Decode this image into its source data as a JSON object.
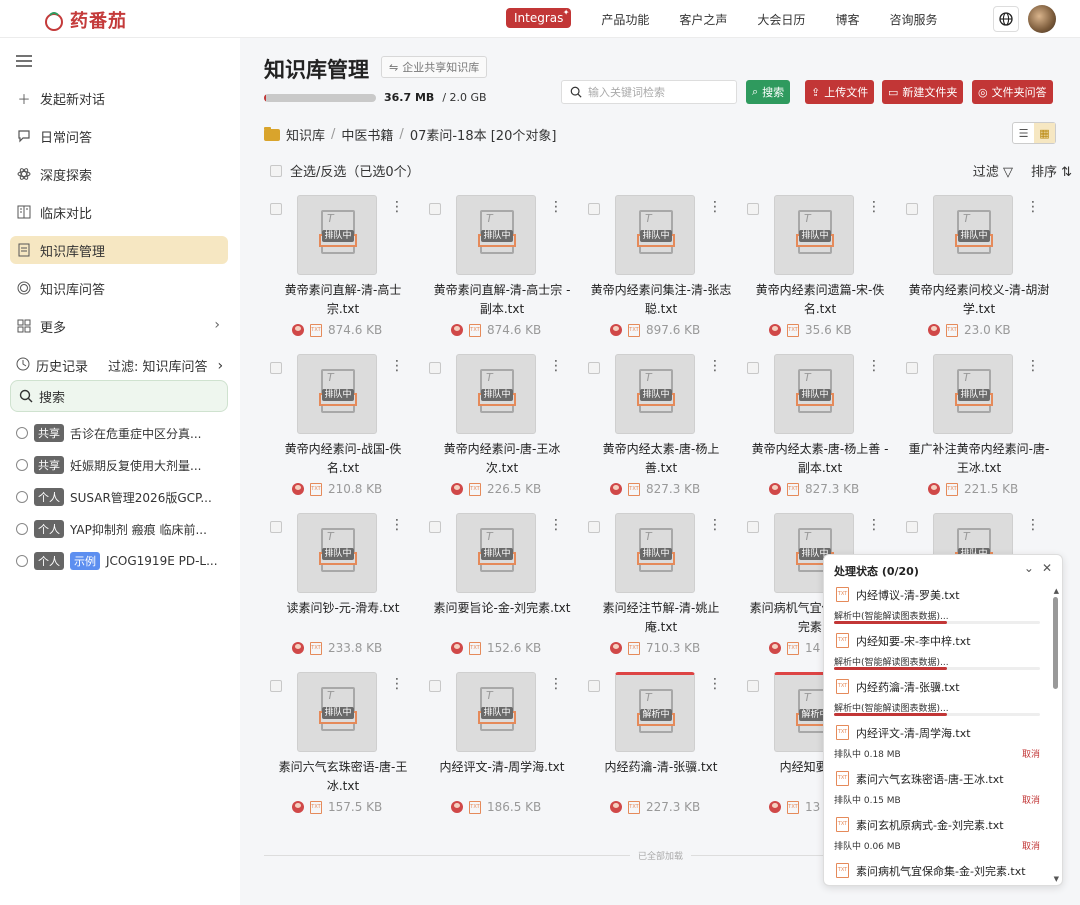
{
  "app": {
    "logo_text": "药番茄"
  },
  "topnav": {
    "pill": "Integras",
    "items": [
      "产品功能",
      "客户之声",
      "大会日历",
      "博客",
      "咨询服务"
    ]
  },
  "sidebar": {
    "items": [
      {
        "label": "发起新对话",
        "icon": "plus-icon"
      },
      {
        "label": "日常问答",
        "icon": "chat-icon"
      },
      {
        "label": "深度探索",
        "icon": "atom-icon"
      },
      {
        "label": "临床对比",
        "icon": "compare-icon"
      },
      {
        "label": "知识库管理",
        "icon": "folder-icon"
      },
      {
        "label": "知识库问答",
        "icon": "target-icon"
      },
      {
        "label": "更多",
        "icon": "grid-icon"
      }
    ],
    "history_label": "历史记录",
    "history_filter": "过滤: 知识库问答",
    "search_label": "搜索",
    "conversations": [
      {
        "tag": "共享",
        "tag_color": "#666666",
        "title": "舌诊在危重症中区分真..."
      },
      {
        "tag": "共享",
        "tag_color": "#666666",
        "title": "妊娠期反复使用大剂量..."
      },
      {
        "tag": "个人",
        "tag_color": "#666666",
        "title": "SUSAR管理2026版GCP..."
      },
      {
        "tag": "个人",
        "tag_color": "#666666",
        "title": "YAP抑制剂 瘢痕 临床前..."
      },
      {
        "tag": "个人",
        "tag_color": "#666666",
        "tag2": "示例",
        "tag2_color": "#5d8ff0",
        "title": "JCOG1919E PD-L..."
      }
    ]
  },
  "main": {
    "title": "知识库管理",
    "share_label": "企业共享知识库",
    "usage_used": "36.7 MB",
    "usage_total": "/ 2.0 GB",
    "usage_fraction": 0.018,
    "search_placeholder": "输入关键词检索",
    "buttons": {
      "search": "搜索",
      "upload": "上传文件",
      "new_folder": "新建文件夹",
      "folder_qa": "文件夹问答"
    },
    "breadcrumb": [
      "知识库",
      "中医书籍",
      "07素问-18本 [20个对象]"
    ],
    "select_all": "全选/反选（已选0个）",
    "filter": "过滤",
    "sort": "排序",
    "end_text": "已全部加载",
    "thumb_t": "T",
    "thumb_txt": "TXT",
    "files": [
      {
        "name": "黄帝素问直解-清-高士宗.txt",
        "size": "874.6 KB",
        "status": "排队中"
      },
      {
        "name": "黄帝素问直解-清-高士宗 - 副本.txt",
        "size": "874.6 KB",
        "status": "排队中"
      },
      {
        "name": "黄帝内经素问集注-清-张志聪.txt",
        "size": "897.6 KB",
        "status": "排队中"
      },
      {
        "name": "黄帝内经素问遗篇-宋-佚名.txt",
        "size": "35.6 KB",
        "status": "排队中"
      },
      {
        "name": "黄帝内经素问校义-清-胡澍学.txt",
        "size": "23.0 KB",
        "status": "排队中"
      },
      {
        "name": "黄帝内经素问-战国-佚名.txt",
        "size": "210.8 KB",
        "status": "排队中"
      },
      {
        "name": "黄帝内经素问-唐-王冰次.txt",
        "size": "226.5 KB",
        "status": "排队中"
      },
      {
        "name": "黄帝内经太素-唐-杨上善.txt",
        "size": "827.3 KB",
        "status": "排队中"
      },
      {
        "name": "黄帝内经太素-唐-杨上善 - 副本.txt",
        "size": "827.3 KB",
        "status": "排队中"
      },
      {
        "name": "重广补注黄帝内经素问-唐-王冰.txt",
        "size": "221.5 KB",
        "status": "排队中"
      },
      {
        "name": "读素问钞-元-滑寿.txt",
        "size": "233.8 KB",
        "status": "排队中"
      },
      {
        "name": "素问要旨论-金-刘完素.txt",
        "size": "152.6 KB",
        "status": "排队中"
      },
      {
        "name": "素问经注节解-清-姚止庵.txt",
        "size": "710.3 KB",
        "status": "排队中"
      },
      {
        "name": "素问病机气宜保命集-金-刘完素.txt",
        "size": "14",
        "status": "排队中"
      },
      {
        "name": "",
        "size": "",
        "status": "排队中"
      },
      {
        "name": "素问六气玄珠密语-唐-王冰.txt",
        "size": "157.5 KB",
        "status": "排队中"
      },
      {
        "name": "内经评文-清-周学海.txt",
        "size": "186.5 KB",
        "status": "排队中"
      },
      {
        "name": "内经药瀹-清-张骥.txt",
        "size": "227.3 KB",
        "status": "解析中"
      },
      {
        "name": "内经知要-宋-李",
        "size": "13",
        "status": "解析中"
      }
    ]
  },
  "panel": {
    "title": "处理状态 (0/20)",
    "cancel_label": "取消",
    "items": [
      {
        "name": "内经博议-清-罗美.txt",
        "status": "解析中(智能解读图表数据)...",
        "progress": 0.55,
        "cancel": false
      },
      {
        "name": "内经知要-宋-李中梓.txt",
        "status": "解析中(智能解读图表数据)...",
        "progress": 0.55,
        "cancel": false
      },
      {
        "name": "内经药瀹-清-张骥.txt",
        "status": "解析中(智能解读图表数据)...",
        "progress": 0.55,
        "cancel": false
      },
      {
        "name": "内经评文-清-周学海.txt",
        "status": "排队中 0.18 MB",
        "cancel": true
      },
      {
        "name": "素问六气玄珠密语-唐-王冰.txt",
        "status": "排队中 0.15 MB",
        "cancel": true
      },
      {
        "name": "素问玄机原病式-金-刘完素.txt",
        "status": "排队中 0.06 MB",
        "cancel": true
      },
      {
        "name": "素问病机气宜保命集-金-刘完素.txt",
        "status": "",
        "cancel": false
      }
    ]
  },
  "colors": {
    "brand": "#c23636",
    "active_nav": "#f6e7c2",
    "success": "#2f9a5e"
  }
}
